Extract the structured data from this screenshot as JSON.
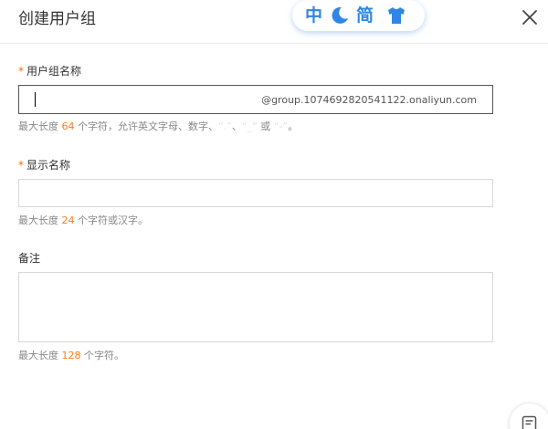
{
  "dialog": {
    "title": "创建用户组",
    "close_icon": "close-icon"
  },
  "ime_toolbar": {
    "input_mode": "中",
    "moon_icon": "moon-icon",
    "script_mode": "简",
    "skin_icon": "tshirt-icon"
  },
  "form": {
    "group_name": {
      "required_mark": "*",
      "label": "用户组名称",
      "value": "",
      "suffix": "@group.1074692820541122.onaliyun.com",
      "hint_before": "最大长度 ",
      "hint_number": "64",
      "hint_middle": " 个字符，允许英文字母、数字、",
      "hint_dot": "“.”",
      "hint_sep": "、",
      "hint_underscore": "“_”",
      "hint_or": " 或 ",
      "hint_dash": "“-”",
      "hint_end": "。"
    },
    "display_name": {
      "required_mark": "*",
      "label": "显示名称",
      "value": "",
      "hint_before": "最大长度 ",
      "hint_number": "24",
      "hint_after": " 个字符或汉字。"
    },
    "remark": {
      "label": "备注",
      "value": "",
      "hint_before": "最大长度 ",
      "hint_number": "128",
      "hint_after": " 个字符。"
    }
  },
  "feedback": {
    "icon": "feedback-icon"
  },
  "colors": {
    "accent": "#ff6a00",
    "ime_blue": "#2f86e6",
    "hint_gray": "#888888",
    "border": "#d7d8d9"
  }
}
